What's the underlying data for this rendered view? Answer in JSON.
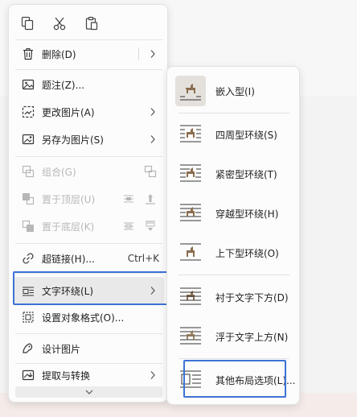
{
  "clipboard": {
    "icons": [
      "copy-icon",
      "cut-icon",
      "paste-icon"
    ]
  },
  "menu": {
    "delete": {
      "label": "删除(D)"
    },
    "caption": {
      "label": "题注(Z)..."
    },
    "change_picture": {
      "label": "更改图片(A)"
    },
    "save_as_picture": {
      "label": "另存为图片(S)"
    },
    "group": {
      "label": "组合(G)"
    },
    "bring_to_front": {
      "label": "置于顶层(U)"
    },
    "send_to_back": {
      "label": "置于底层(K)"
    },
    "hyperlink": {
      "label": "超链接(H)...",
      "shortcut": "Ctrl+K"
    },
    "wrap_text": {
      "label": "文字环绕(L)"
    },
    "format_object": {
      "label": "设置对象格式(O)..."
    },
    "design_picture": {
      "label": "设计图片"
    },
    "extract_convert": {
      "label": "提取与转换"
    }
  },
  "submenu": {
    "items": [
      {
        "label": "嵌入型(I)",
        "icon": "inline-wrap-icon",
        "selected": true
      },
      {
        "label": "四周型环绕(S)",
        "icon": "square-wrap-icon"
      },
      {
        "label": "紧密型环绕(T)",
        "icon": "tight-wrap-icon"
      },
      {
        "label": "穿越型环绕(H)",
        "icon": "through-wrap-icon"
      },
      {
        "label": "上下型环绕(O)",
        "icon": "top-bottom-wrap-icon"
      },
      {
        "label": "衬于文字下方(D)",
        "icon": "behind-text-icon"
      },
      {
        "label": "浮于文字上方(N)",
        "icon": "in-front-text-icon"
      },
      {
        "label": "其他布局选项(L)...",
        "icon": "more-layout-icon"
      }
    ]
  },
  "colors": {
    "highlight_border": "#3d72d6",
    "dog_glyph": "#8a6e4f",
    "disabled_text": "#b7b7b7"
  }
}
